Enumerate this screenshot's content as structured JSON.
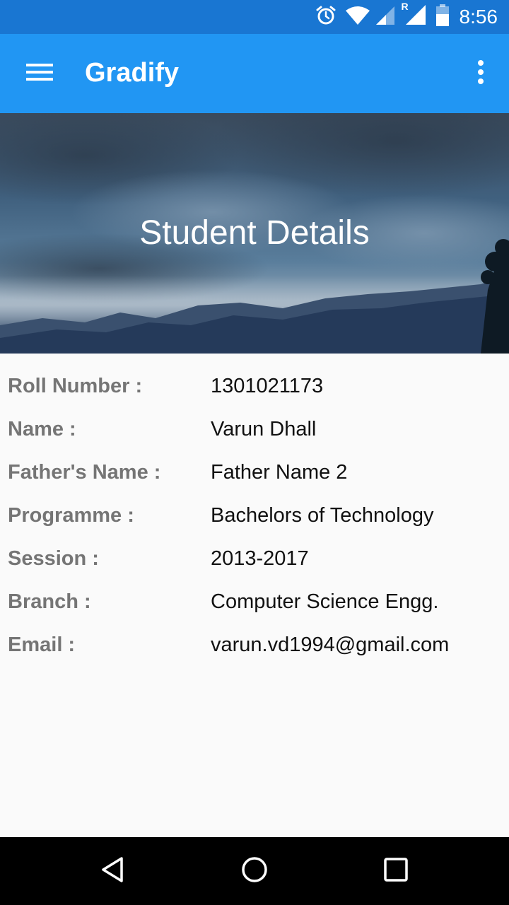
{
  "status_bar": {
    "time": "8:56",
    "icons": [
      "alarm-icon",
      "wifi-icon",
      "signal-icon",
      "roaming-signal-icon",
      "battery-icon"
    ],
    "roaming_indicator": "R"
  },
  "app_bar": {
    "title": "Gradify",
    "icons": [
      "menu-icon",
      "overflow-menu-icon"
    ]
  },
  "hero": {
    "title": "Student Details"
  },
  "details": [
    {
      "label": "Roll Number :",
      "value": "1301021173"
    },
    {
      "label": "Name :",
      "value": "Varun Dhall"
    },
    {
      "label": "Father's Name :",
      "value": "Father Name 2"
    },
    {
      "label": "Programme :",
      "value": "Bachelors of Technology"
    },
    {
      "label": "Session :",
      "value": "2013-2017"
    },
    {
      "label": "Branch :",
      "value": "Computer Science Engg."
    },
    {
      "label": "Email :",
      "value": "varun.vd1994@gmail.com"
    }
  ],
  "nav_bar": {
    "icons": [
      "back-icon",
      "home-icon",
      "recents-icon"
    ]
  },
  "colors": {
    "status_bar": "#1976d2",
    "app_bar": "#2196f3",
    "label_text": "#757575",
    "value_text": "#111111",
    "background": "#fafafa"
  }
}
